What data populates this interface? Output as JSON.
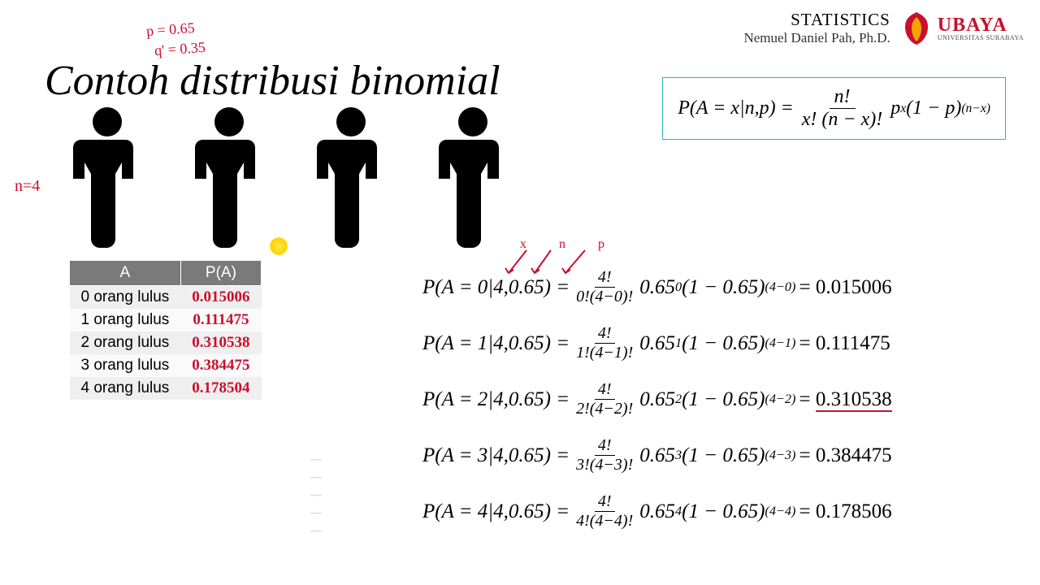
{
  "header": {
    "course": "STATISTICS",
    "author": "Nemuel Daniel Pah, Ph.D.",
    "logo_name": "UBAYA",
    "logo_sub": "UNIVERSITAS SURABAYA"
  },
  "title": "Contoh distribusi binomial",
  "handwriting": {
    "p": "p = 0.65",
    "q": "q' = 0.35",
    "n": "n=4",
    "x_label": "(X)",
    "xnp_labels": "x n p"
  },
  "formula": {
    "lhs": "P(A = x|n,p) =",
    "num": "n!",
    "den": "x! (n − x)!",
    "rhs_p": "p",
    "rhs_p_exp": "x",
    "rhs_q": "(1 − p)",
    "rhs_q_exp": "(n−x)"
  },
  "table": {
    "col_a": "A",
    "col_pa": "P(A)",
    "rows": [
      {
        "a": "0 orang lulus",
        "pa": "0.015006"
      },
      {
        "a": "1 orang lulus",
        "pa": "0.111475"
      },
      {
        "a": "2 orang lulus",
        "pa": "0.310538"
      },
      {
        "a": "3 orang lulus",
        "pa": "0.384475"
      },
      {
        "a": "4 orang lulus",
        "pa": "0.178504"
      }
    ]
  },
  "calc": [
    {
      "lhs": "P(A = 0|4,0.65) =",
      "num": "4!",
      "den": "0!(4−0)!",
      "p_exp": "0",
      "q_exp": "(4−0)",
      "result": "0.015006"
    },
    {
      "lhs": "P(A = 1|4,0.65) =",
      "num": "4!",
      "den": "1!(4−1)!",
      "p_exp": "1",
      "q_exp": "(4−1)",
      "result": "0.111475"
    },
    {
      "lhs": "P(A = 2|4,0.65) =",
      "num": "4!",
      "den": "2!(4−2)!",
      "p_exp": "2",
      "q_exp": "(4−2)",
      "result": "0.310538"
    },
    {
      "lhs": "P(A = 3|4,0.65) =",
      "num": "4!",
      "den": "3!(4−3)!",
      "p_exp": "3",
      "q_exp": "(4−3)",
      "result": "0.384475"
    },
    {
      "lhs": "P(A = 4|4,0.65) =",
      "num": "4!",
      "den": "4!(4−4)!",
      "p_exp": "4",
      "q_exp": "(4−4)",
      "result": "0.178506"
    }
  ],
  "dashes": [
    "—",
    "—",
    "—",
    "—",
    "—"
  ]
}
